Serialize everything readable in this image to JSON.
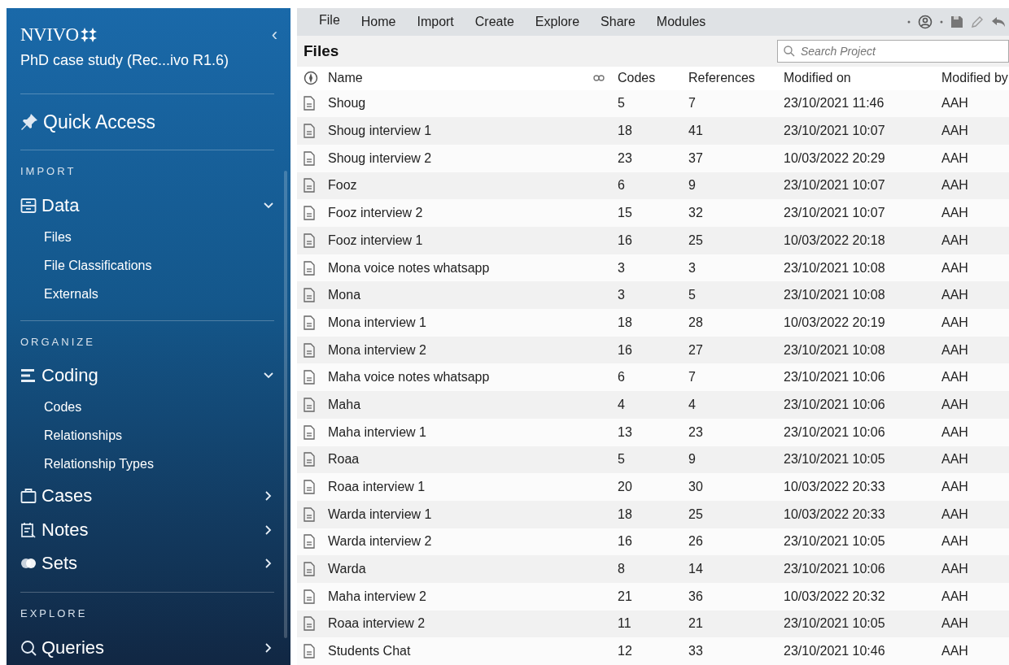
{
  "sidebar": {
    "logo": "NVIVO",
    "project": "PhD case study (Rec...ivo R1.6)",
    "collapse": "‹",
    "quick_access": "Quick Access",
    "sections": [
      {
        "heading": "IMPORT",
        "items": [
          {
            "label": "Data",
            "expanded": true,
            "children": [
              {
                "label": "Files"
              },
              {
                "label": "File Classifications"
              },
              {
                "label": "Externals"
              }
            ]
          }
        ]
      },
      {
        "heading": "ORGANIZE",
        "items": [
          {
            "label": "Coding",
            "expanded": true,
            "children": [
              {
                "label": "Codes"
              },
              {
                "label": "Relationships"
              },
              {
                "label": "Relationship Types"
              }
            ]
          },
          {
            "label": "Cases",
            "expanded": false
          },
          {
            "label": "Notes",
            "expanded": false
          },
          {
            "label": "Sets",
            "expanded": false
          }
        ]
      },
      {
        "heading": "EXPLORE",
        "items": [
          {
            "label": "Queries",
            "expanded": false
          }
        ]
      }
    ]
  },
  "menu": [
    "File",
    "Home",
    "Import",
    "Create",
    "Explore",
    "Share",
    "Modules"
  ],
  "title": "Files",
  "search": {
    "placeholder": "Search Project"
  },
  "table": {
    "columns": [
      "Name",
      "Codes",
      "References",
      "Modified on",
      "Modified by"
    ],
    "rows": [
      [
        "Shoug",
        "5",
        "7",
        "23/10/2021 11:46",
        "AAH"
      ],
      [
        "Shoug interview 1",
        "18",
        "41",
        "23/10/2021 10:07",
        "AAH"
      ],
      [
        "Shoug interview 2",
        "23",
        "37",
        "10/03/2022 20:29",
        "AAH"
      ],
      [
        "Fooz",
        "6",
        "9",
        "23/10/2021 10:07",
        "AAH"
      ],
      [
        "Fooz interview 2",
        "15",
        "32",
        "23/10/2021 10:07",
        "AAH"
      ],
      [
        "Fooz interview 1",
        "16",
        "25",
        "10/03/2022 20:18",
        "AAH"
      ],
      [
        "Mona voice notes whatsapp",
        "3",
        "3",
        "23/10/2021 10:08",
        "AAH"
      ],
      [
        "Mona",
        "3",
        "5",
        "23/10/2021 10:08",
        "AAH"
      ],
      [
        "Mona interview 1",
        "18",
        "28",
        "10/03/2022 20:19",
        "AAH"
      ],
      [
        "Mona interview 2",
        "16",
        "27",
        "23/10/2021 10:08",
        "AAH"
      ],
      [
        "Maha voice notes whatsapp",
        "6",
        "7",
        "23/10/2021 10:06",
        "AAH"
      ],
      [
        "Maha",
        "4",
        "4",
        "23/10/2021 10:06",
        "AAH"
      ],
      [
        "Maha interview 1",
        "13",
        "23",
        "23/10/2021 10:06",
        "AAH"
      ],
      [
        "Roaa",
        "5",
        "9",
        "23/10/2021 10:05",
        "AAH"
      ],
      [
        "Roaa interview 1",
        "20",
        "30",
        "10/03/2022 20:33",
        "AAH"
      ],
      [
        "Warda interview 1",
        "18",
        "25",
        "10/03/2022 20:33",
        "AAH"
      ],
      [
        "Warda interview 2",
        "16",
        "26",
        "23/10/2021 10:05",
        "AAH"
      ],
      [
        "Warda",
        "8",
        "14",
        "23/10/2021 10:06",
        "AAH"
      ],
      [
        "Maha interview 2",
        "21",
        "36",
        "10/03/2022 20:32",
        "AAH"
      ],
      [
        "Roaa interview 2",
        "11",
        "21",
        "23/10/2021 10:05",
        "AAH"
      ],
      [
        "Students Chat",
        "12",
        "33",
        "23/10/2021 10:46",
        "AAH"
      ]
    ]
  }
}
